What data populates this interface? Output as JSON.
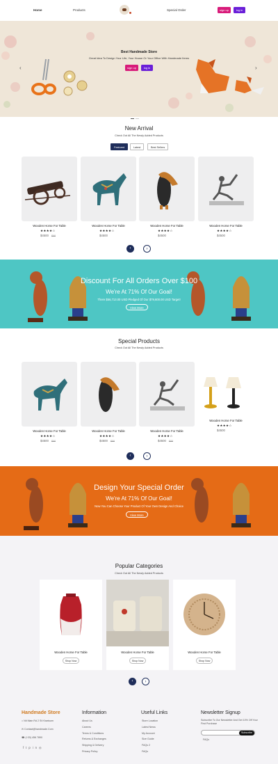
{
  "header": {
    "nav": [
      "Home",
      "Products",
      "Special Order"
    ],
    "signup": "sign up",
    "login": "log in"
  },
  "hero": {
    "title": "Best Handmade Store",
    "subtitle": "Great Idea To Design Your Life, Your House Or Your Office With Handmade Items",
    "signup": "sign up",
    "login": "log in",
    "prev": "‹",
    "next": "›"
  },
  "new_arrival": {
    "title": "New Arrival",
    "subtitle": "Check Out All The Newly Added Products",
    "tabs": [
      "Featured",
      "Latest",
      "Best Sellers"
    ],
    "cards": [
      {
        "name": "Wooden Horse For Table",
        "stars": "★★★★☆",
        "price": "$4500",
        "old": "$88"
      },
      {
        "name": "Wooden Horse For Table",
        "stars": "★★★★☆",
        "price": "$4500",
        "old": ""
      },
      {
        "name": "Wooden Horse For Table",
        "stars": "★★★★☆",
        "price": "$4500",
        "old": ""
      },
      {
        "name": "Wooden Horse For Table",
        "stars": "★★★★☆",
        "price": "$4500",
        "old": ""
      }
    ]
  },
  "banner1": {
    "heading": "Discount For All Orders Over $100",
    "sub": "We're At 71% Of Our Goal!",
    "text": "There $56,713.00 USD Pledged Of Our $79,600.00 USD Target!",
    "button": "View More"
  },
  "special": {
    "title": "Special Products",
    "subtitle": "Check Out All The Newly Added Products",
    "cards": [
      {
        "name": "Wooden Horse For Table",
        "stars": "★★★★☆",
        "price": "$4500",
        "old": "$88"
      },
      {
        "name": "Wooden Horse For Table",
        "stars": "★★★★☆",
        "price": "$4500",
        "old": "$88"
      },
      {
        "name": "Wooden Horse For Table",
        "stars": "★★★★☆",
        "price": "$4500",
        "old": "$88"
      },
      {
        "name": "Wooden Horse For Table",
        "stars": "★★★★☆",
        "price": "$4500",
        "old": ""
      }
    ]
  },
  "banner2": {
    "heading": "Design Your Special Order",
    "sub": "We're At 71% Of Our Goal!",
    "text": "Now You Can Choose Your Product Of Your Own Design And Choice",
    "button": "View More"
  },
  "categories": {
    "title": "Popular Categories",
    "subtitle": "Check Out All The Newly Added Products",
    "cards": [
      {
        "name": "Wooden Horse For Table",
        "button": "Shop Now"
      },
      {
        "name": "Wooden Horse For Table",
        "button": "Shop Now"
      },
      {
        "name": "Wooden Horse For Table",
        "button": "Shop Now"
      }
    ]
  },
  "footer": {
    "brand": "Handmade Store",
    "address": "Nit Main Rd 2 St Khartoum",
    "email": "Contact@handmade.Com",
    "phone": "(+20) 456 7890",
    "info_title": "Information",
    "info_links": [
      "About Us",
      "Careers",
      "Terms & Conditions",
      "Returns & Exchanges",
      "Shipping & Delivery",
      "Privacy Policy"
    ],
    "useful_title": "Useful Links",
    "useful_links": [
      "Store Location",
      "Latest News",
      "My Account",
      "Size Guide",
      "FAQs 2",
      "FAQs"
    ],
    "news_title": "Newsletter Signup",
    "news_text": "Subscribe To Our Newsletter And Get 10% Off Your First Purchase",
    "subscribe": "Subscribe",
    "faqs": "FAQs"
  },
  "colors": {
    "navy": "#1e2d5a",
    "teal": "#4ec6c4",
    "orange": "#e56b16",
    "brand": "#d07a1f"
  }
}
